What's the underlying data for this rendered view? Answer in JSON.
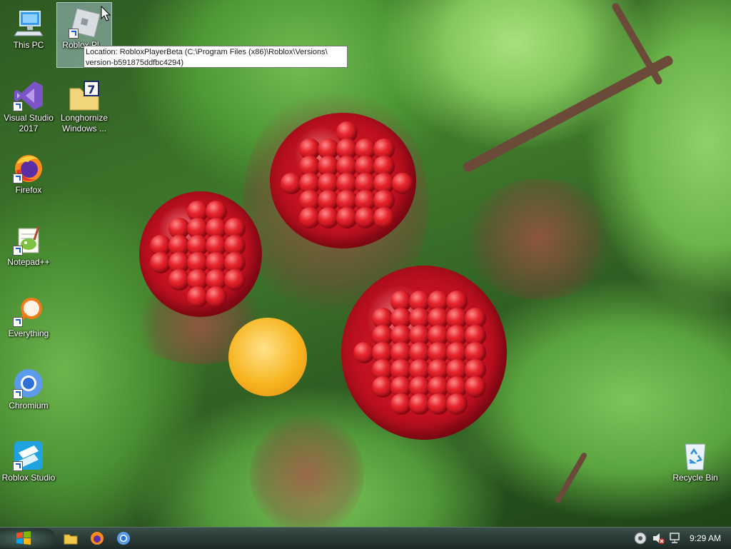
{
  "desktop_icons": [
    {
      "id": "this_pc",
      "label": "This PC"
    },
    {
      "id": "roblox_player",
      "label": "Roblox Pl..."
    },
    {
      "id": "visual_studio",
      "label": "Visual Studio 2017"
    },
    {
      "id": "longhorn",
      "label": "Longhornize Windows ..."
    },
    {
      "id": "firefox",
      "label": "Firefox"
    },
    {
      "id": "notepadpp",
      "label": "Notepad++"
    },
    {
      "id": "everything",
      "label": "Everything"
    },
    {
      "id": "chromium",
      "label": "Chromium"
    },
    {
      "id": "roblox_studio",
      "label": "Roblox Studio"
    },
    {
      "id": "recycle_bin",
      "label": "Recycle Bin"
    }
  ],
  "tooltip": {
    "line1": "Location: RobloxPlayerBeta (C:\\Program Files (x86)\\Roblox\\Versions\\",
    "line2": "version-b591875ddfbc4294)"
  },
  "taskbar": {
    "pinned": [
      "file-explorer-icon",
      "firefox-icon",
      "chromium-icon"
    ],
    "tray": {
      "time": "9:29 AM"
    }
  },
  "colors": {
    "selection": "#bed7f0",
    "taskbar": "#2a3b37"
  }
}
